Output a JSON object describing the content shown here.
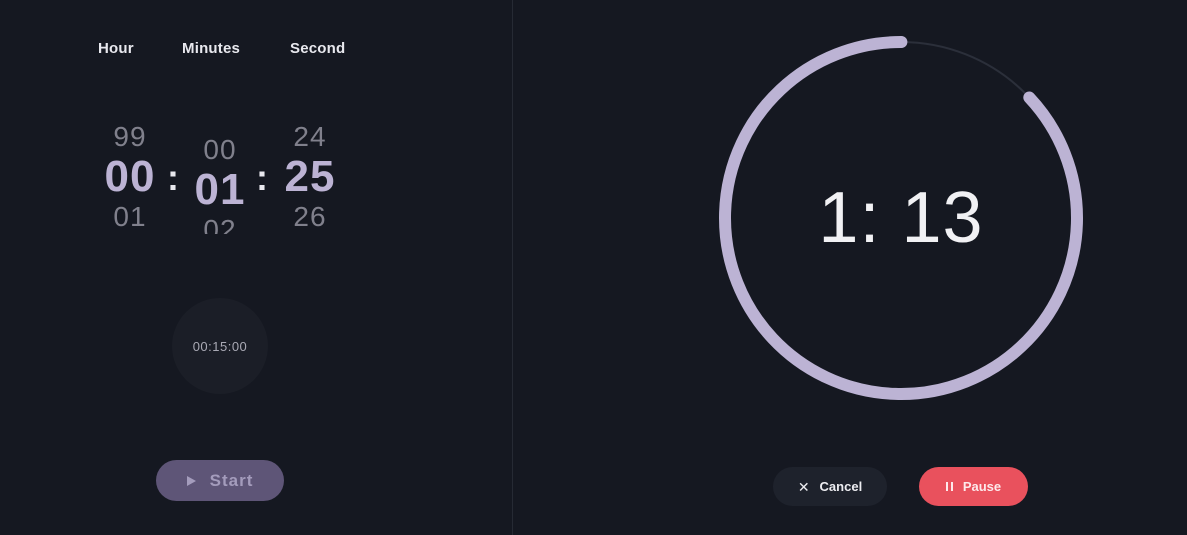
{
  "columns": {
    "hour": "Hour",
    "minutes": "Minutes",
    "second": "Second"
  },
  "picker": {
    "hour": {
      "prev": "99",
      "current": "00",
      "next": "01"
    },
    "minutes": {
      "prev": "00",
      "current": "01",
      "next": "02"
    },
    "second": {
      "prev": "24",
      "current": "25",
      "next": "26"
    },
    "separator": ":"
  },
  "preset": {
    "label": "00:15:00"
  },
  "start": {
    "label": "Start",
    "icon": "play-icon"
  },
  "timer": {
    "display": "1: 13",
    "progress": 0.87,
    "colors": {
      "track": "#2b2f3a",
      "fill": "#bcb3d4"
    }
  },
  "actions": {
    "cancel": {
      "label": "Cancel",
      "icon": "close-icon"
    },
    "pause": {
      "label": "Pause",
      "icon": "pause-icon"
    }
  },
  "colors": {
    "background": "#151821",
    "accent": "#bcb3d4",
    "pause": "#e9515d"
  }
}
